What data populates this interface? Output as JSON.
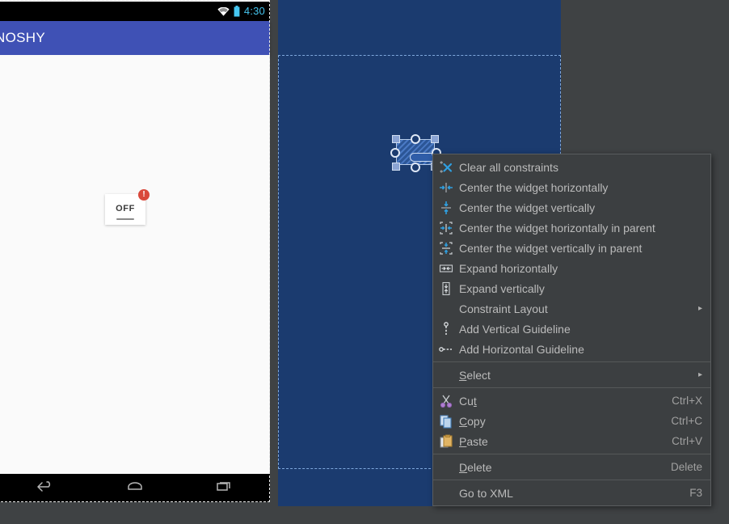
{
  "design": {
    "status_bar": {
      "time": "4:30",
      "icons": [
        "wifi-icon",
        "battery-icon"
      ]
    },
    "app_bar": {
      "title": "NOSHY"
    },
    "widget": {
      "label": "OFF",
      "badge": "!"
    },
    "nav_bar": {
      "buttons": [
        "back-icon",
        "home-icon",
        "recents-icon"
      ]
    }
  },
  "blueprint": {
    "selected_widget": "switch-widget",
    "root_layout": "ConstraintLayout"
  },
  "context_menu": {
    "items": [
      {
        "label": "Clear all constraints",
        "icon": "clear-constraints-icon",
        "accel": "",
        "arrow": "",
        "sep_after": false
      },
      {
        "label": "Center the widget horizontally",
        "icon": "center-horizontal-icon",
        "accel": "",
        "arrow": "",
        "sep_after": false
      },
      {
        "label": "Center the widget vertically",
        "icon": "center-vertical-icon",
        "accel": "",
        "arrow": "",
        "sep_after": false
      },
      {
        "label": "Center the widget horizontally in parent",
        "icon": "center-horizontal-parent-icon",
        "accel": "",
        "arrow": "",
        "sep_after": false
      },
      {
        "label": "Center the widget vertically in parent",
        "icon": "center-vertical-parent-icon",
        "accel": "",
        "arrow": "",
        "sep_after": false
      },
      {
        "label": "Expand horizontally",
        "icon": "expand-horizontal-icon",
        "accel": "",
        "arrow": "",
        "sep_after": false
      },
      {
        "label": "Expand vertically",
        "icon": "expand-vertical-icon",
        "accel": "",
        "arrow": "",
        "sep_after": false
      },
      {
        "label": "Constraint Layout",
        "icon": "",
        "accel": "",
        "arrow": "▸",
        "sep_after": false
      },
      {
        "label": "Add Vertical Guideline",
        "icon": "vertical-guideline-icon",
        "accel": "",
        "arrow": "",
        "sep_after": false
      },
      {
        "label": "Add Horizontal Guideline",
        "icon": "horizontal-guideline-icon",
        "accel": "",
        "arrow": "",
        "sep_after": true
      },
      {
        "label": "Select",
        "mnemonic": "S",
        "icon": "",
        "accel": "",
        "arrow": "▸",
        "sep_after": true
      },
      {
        "label": "Cut",
        "mnemonic": "t",
        "icon": "cut-icon",
        "accel": "Ctrl+X",
        "arrow": "",
        "sep_after": false
      },
      {
        "label": "Copy",
        "mnemonic": "C",
        "icon": "copy-icon",
        "accel": "Ctrl+C",
        "arrow": "",
        "sep_after": false
      },
      {
        "label": "Paste",
        "mnemonic": "P",
        "icon": "paste-icon",
        "accel": "Ctrl+V",
        "arrow": "",
        "sep_after": true
      },
      {
        "label": "Delete",
        "mnemonic": "D",
        "icon": "",
        "accel": "Delete",
        "arrow": "",
        "sep_after": true
      },
      {
        "label": "Go to XML",
        "icon": "",
        "accel": "F3",
        "arrow": "",
        "sep_after": false
      }
    ]
  },
  "colors": {
    "app_bar": "#3f51b5",
    "blueprint_bg": "#1b3b6f",
    "menu_bg": "#3c3f41",
    "menu_text": "#bbbbbb",
    "accent_blue": "#1da1e2",
    "error_red": "#d9483b",
    "status_time": "#46c6f0"
  }
}
